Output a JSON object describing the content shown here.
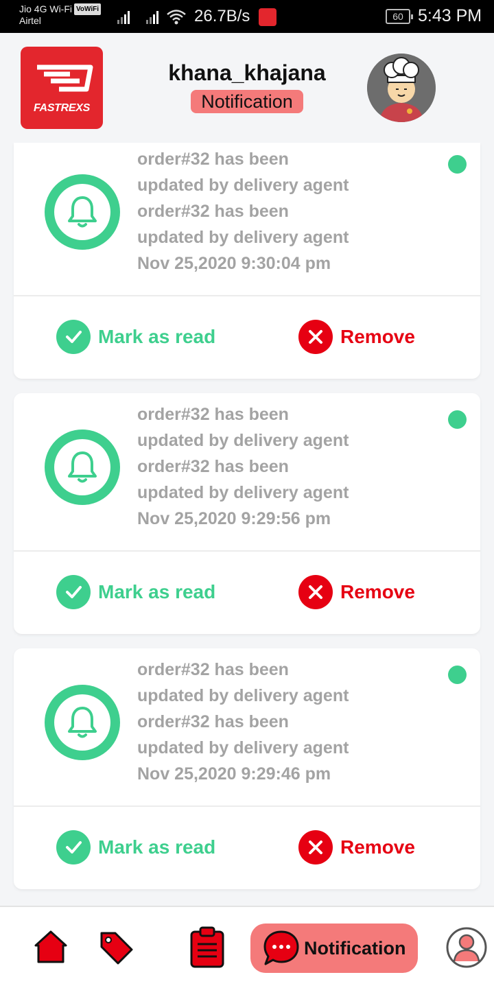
{
  "status_bar": {
    "carrier_line1": "Jio 4G Wi-Fi",
    "vowifi": "VoWiFi",
    "carrier_line2": "Airtel",
    "speed": "26.7B/s",
    "battery": "60",
    "time": "5:43 PM"
  },
  "header": {
    "logo_text": "FASTREXS",
    "title": "khana_khajana",
    "badge": "Notification"
  },
  "notifications": [
    {
      "lines": [
        "order#32 has been",
        "updated by delivery agent",
        "order#32 has been",
        "updated by delivery agent"
      ],
      "timestamp": "Nov 25,2020 9:30:04 pm",
      "mark_read_label": "Mark as read",
      "remove_label": "Remove"
    },
    {
      "lines": [
        "order#32 has been",
        "updated by delivery agent",
        "order#32 has been",
        "updated by delivery agent"
      ],
      "timestamp": "Nov 25,2020 9:29:56 pm",
      "mark_read_label": "Mark as read",
      "remove_label": "Remove"
    },
    {
      "lines": [
        "order#32 has been",
        "updated by delivery agent",
        "order#32 has been",
        "updated by delivery agent"
      ],
      "timestamp": "Nov 25,2020 9:29:46 pm",
      "mark_read_label": "Mark as read",
      "remove_label": "Remove"
    }
  ],
  "bottom_nav": {
    "items": [
      "home-icon",
      "tag-icon",
      "clipboard-icon",
      "chat-icon",
      "profile-icon"
    ],
    "active_label": "Notification"
  },
  "colors": {
    "brand_red": "#e3262d",
    "accent_green": "#3ecf8e",
    "remove_red": "#e60012",
    "badge_pink": "#f47a7a"
  }
}
